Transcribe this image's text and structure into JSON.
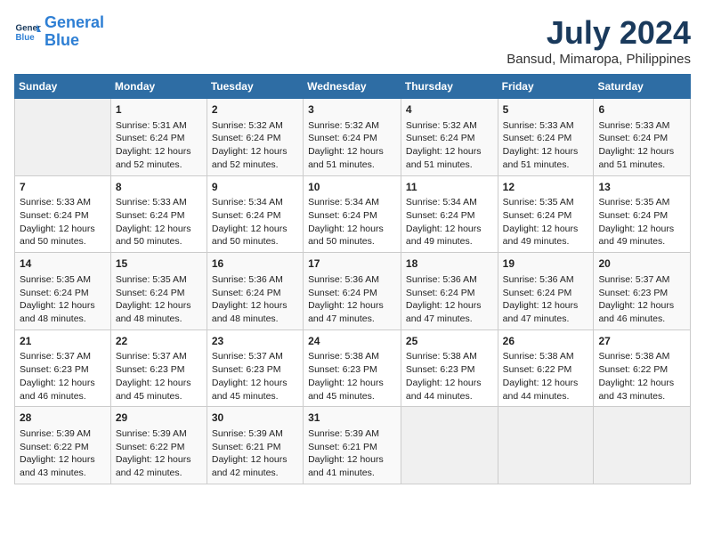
{
  "logo": {
    "line1": "General",
    "line2": "Blue"
  },
  "title": "July 2024",
  "subtitle": "Bansud, Mimaropa, Philippines",
  "days_of_week": [
    "Sunday",
    "Monday",
    "Tuesday",
    "Wednesday",
    "Thursday",
    "Friday",
    "Saturday"
  ],
  "weeks": [
    [
      {
        "num": "",
        "info": ""
      },
      {
        "num": "1",
        "info": "Sunrise: 5:31 AM\nSunset: 6:24 PM\nDaylight: 12 hours\nand 52 minutes."
      },
      {
        "num": "2",
        "info": "Sunrise: 5:32 AM\nSunset: 6:24 PM\nDaylight: 12 hours\nand 52 minutes."
      },
      {
        "num": "3",
        "info": "Sunrise: 5:32 AM\nSunset: 6:24 PM\nDaylight: 12 hours\nand 51 minutes."
      },
      {
        "num": "4",
        "info": "Sunrise: 5:32 AM\nSunset: 6:24 PM\nDaylight: 12 hours\nand 51 minutes."
      },
      {
        "num": "5",
        "info": "Sunrise: 5:33 AM\nSunset: 6:24 PM\nDaylight: 12 hours\nand 51 minutes."
      },
      {
        "num": "6",
        "info": "Sunrise: 5:33 AM\nSunset: 6:24 PM\nDaylight: 12 hours\nand 51 minutes."
      }
    ],
    [
      {
        "num": "7",
        "info": "Sunrise: 5:33 AM\nSunset: 6:24 PM\nDaylight: 12 hours\nand 50 minutes."
      },
      {
        "num": "8",
        "info": "Sunrise: 5:33 AM\nSunset: 6:24 PM\nDaylight: 12 hours\nand 50 minutes."
      },
      {
        "num": "9",
        "info": "Sunrise: 5:34 AM\nSunset: 6:24 PM\nDaylight: 12 hours\nand 50 minutes."
      },
      {
        "num": "10",
        "info": "Sunrise: 5:34 AM\nSunset: 6:24 PM\nDaylight: 12 hours\nand 50 minutes."
      },
      {
        "num": "11",
        "info": "Sunrise: 5:34 AM\nSunset: 6:24 PM\nDaylight: 12 hours\nand 49 minutes."
      },
      {
        "num": "12",
        "info": "Sunrise: 5:35 AM\nSunset: 6:24 PM\nDaylight: 12 hours\nand 49 minutes."
      },
      {
        "num": "13",
        "info": "Sunrise: 5:35 AM\nSunset: 6:24 PM\nDaylight: 12 hours\nand 49 minutes."
      }
    ],
    [
      {
        "num": "14",
        "info": "Sunrise: 5:35 AM\nSunset: 6:24 PM\nDaylight: 12 hours\nand 48 minutes."
      },
      {
        "num": "15",
        "info": "Sunrise: 5:35 AM\nSunset: 6:24 PM\nDaylight: 12 hours\nand 48 minutes."
      },
      {
        "num": "16",
        "info": "Sunrise: 5:36 AM\nSunset: 6:24 PM\nDaylight: 12 hours\nand 48 minutes."
      },
      {
        "num": "17",
        "info": "Sunrise: 5:36 AM\nSunset: 6:24 PM\nDaylight: 12 hours\nand 47 minutes."
      },
      {
        "num": "18",
        "info": "Sunrise: 5:36 AM\nSunset: 6:24 PM\nDaylight: 12 hours\nand 47 minutes."
      },
      {
        "num": "19",
        "info": "Sunrise: 5:36 AM\nSunset: 6:24 PM\nDaylight: 12 hours\nand 47 minutes."
      },
      {
        "num": "20",
        "info": "Sunrise: 5:37 AM\nSunset: 6:23 PM\nDaylight: 12 hours\nand 46 minutes."
      }
    ],
    [
      {
        "num": "21",
        "info": "Sunrise: 5:37 AM\nSunset: 6:23 PM\nDaylight: 12 hours\nand 46 minutes."
      },
      {
        "num": "22",
        "info": "Sunrise: 5:37 AM\nSunset: 6:23 PM\nDaylight: 12 hours\nand 45 minutes."
      },
      {
        "num": "23",
        "info": "Sunrise: 5:37 AM\nSunset: 6:23 PM\nDaylight: 12 hours\nand 45 minutes."
      },
      {
        "num": "24",
        "info": "Sunrise: 5:38 AM\nSunset: 6:23 PM\nDaylight: 12 hours\nand 45 minutes."
      },
      {
        "num": "25",
        "info": "Sunrise: 5:38 AM\nSunset: 6:23 PM\nDaylight: 12 hours\nand 44 minutes."
      },
      {
        "num": "26",
        "info": "Sunrise: 5:38 AM\nSunset: 6:22 PM\nDaylight: 12 hours\nand 44 minutes."
      },
      {
        "num": "27",
        "info": "Sunrise: 5:38 AM\nSunset: 6:22 PM\nDaylight: 12 hours\nand 43 minutes."
      }
    ],
    [
      {
        "num": "28",
        "info": "Sunrise: 5:39 AM\nSunset: 6:22 PM\nDaylight: 12 hours\nand 43 minutes."
      },
      {
        "num": "29",
        "info": "Sunrise: 5:39 AM\nSunset: 6:22 PM\nDaylight: 12 hours\nand 42 minutes."
      },
      {
        "num": "30",
        "info": "Sunrise: 5:39 AM\nSunset: 6:21 PM\nDaylight: 12 hours\nand 42 minutes."
      },
      {
        "num": "31",
        "info": "Sunrise: 5:39 AM\nSunset: 6:21 PM\nDaylight: 12 hours\nand 41 minutes."
      },
      {
        "num": "",
        "info": ""
      },
      {
        "num": "",
        "info": ""
      },
      {
        "num": "",
        "info": ""
      }
    ]
  ]
}
